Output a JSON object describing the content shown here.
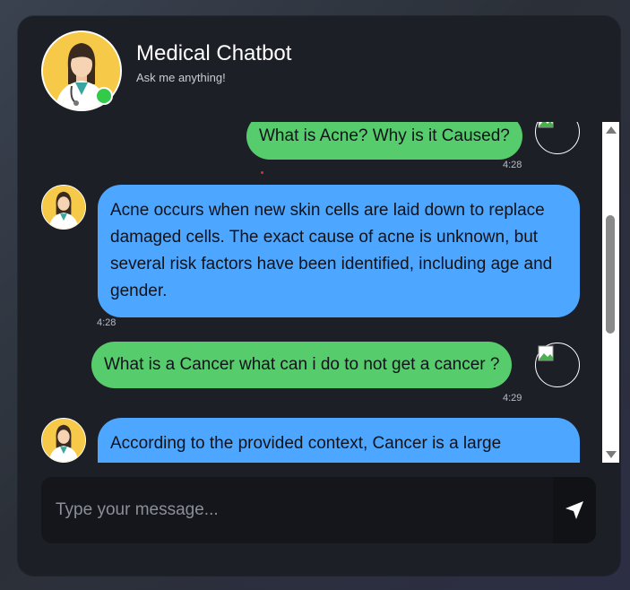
{
  "header": {
    "title": "Medical Chatbot",
    "subtitle": "Ask me anything!",
    "status": "online"
  },
  "messages": [
    {
      "role": "user",
      "text": "What is Acne? Why is it Caused?",
      "time": "4:28"
    },
    {
      "role": "bot",
      "text": "Acne occurs when new skin cells are laid down to replace damaged cells. The exact cause of acne is unknown, but several risk factors have been identified, including age and gender.",
      "time": "4:28"
    },
    {
      "role": "user",
      "text": "What is a Cancer what can i do to not get a cancer ?",
      "time": "4:29"
    },
    {
      "role": "bot",
      "text": "According to the provided context, Cancer is a large",
      "time": ""
    }
  ],
  "composer": {
    "placeholder": "Type your message..."
  },
  "colors": {
    "user_bubble": "#57cc6c",
    "bot_bubble": "#4da6ff",
    "card_bg": "#1d1f27",
    "online": "#33c94a"
  },
  "icons": {
    "send": "paper-plane-icon",
    "bot_avatar": "doctor-avatar-icon",
    "user_avatar": "broken-image-icon"
  }
}
